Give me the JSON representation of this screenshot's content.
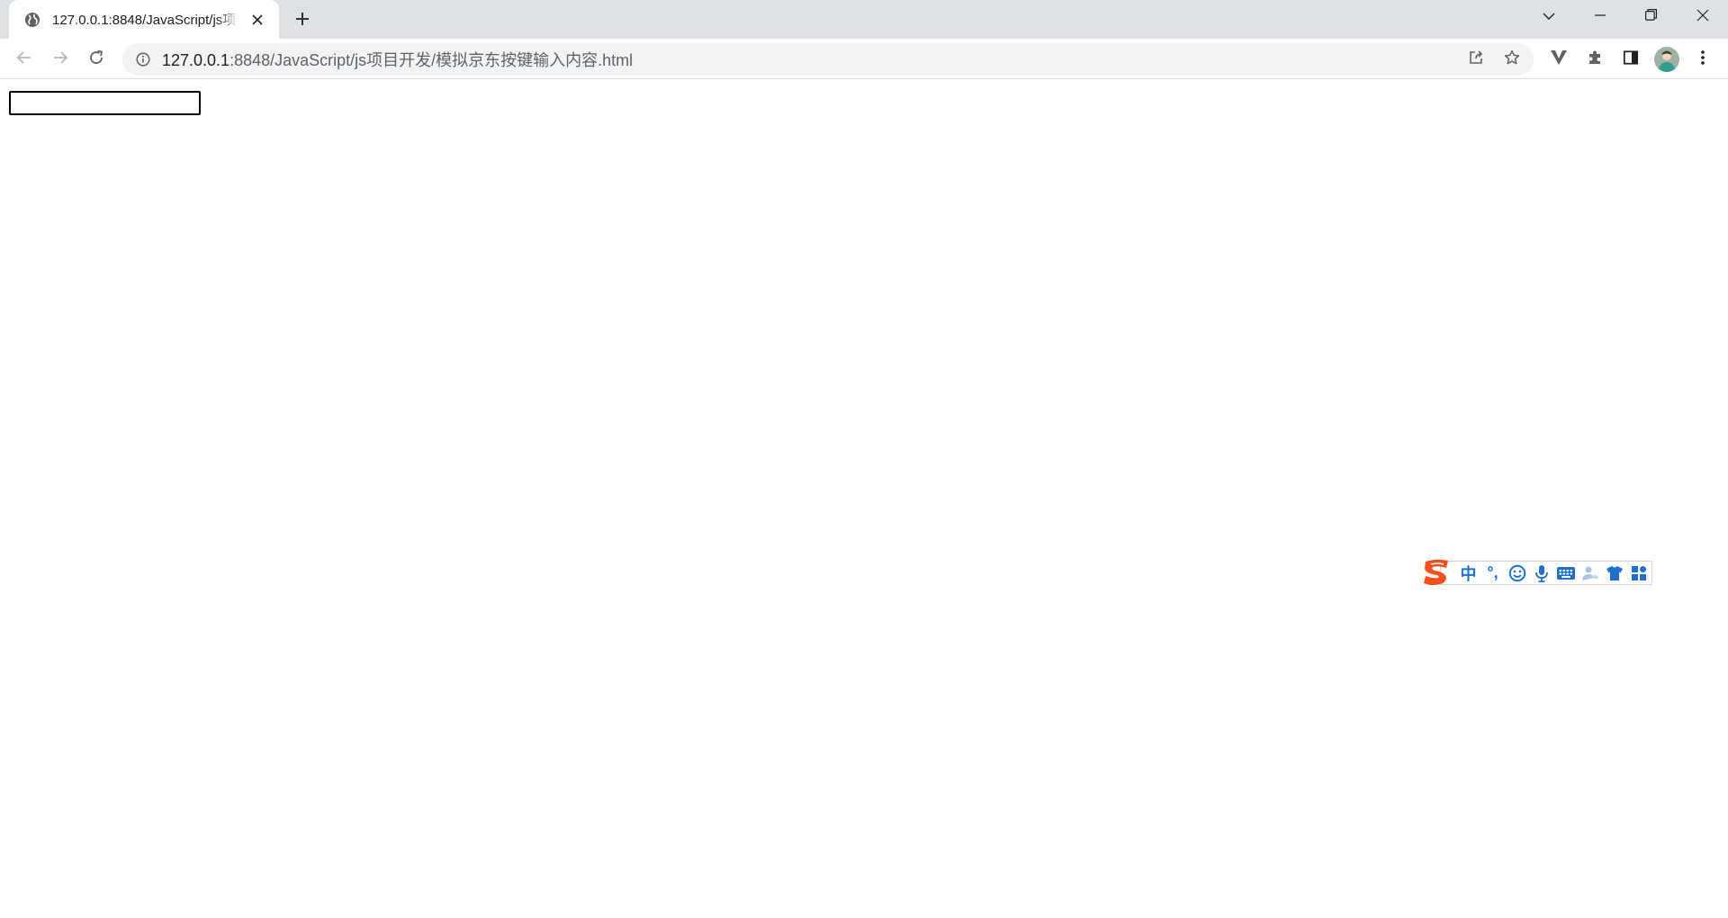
{
  "browser": {
    "tab": {
      "title": "127.0.0.1:8848/JavaScript/js项目开发/模拟京东按键输入内容.html"
    },
    "address_bar": {
      "host": "127.0.0.1",
      "path": ":8848/JavaScript/js项目开发/模拟京东按键输入内容.html"
    },
    "icons": {
      "favicon": "globe-icon",
      "tab_close": "close-icon",
      "new_tab": "plus-icon",
      "tab_search": "chevron-down-icon",
      "minimize": "minimize-icon",
      "restore": "restore-icon",
      "close_window": "close-icon",
      "back": "arrow-left-icon",
      "forward": "arrow-right-icon",
      "reload": "reload-icon",
      "site_info": "info-icon",
      "share": "share-icon",
      "bookmark": "star-icon",
      "extension_v": "v-extension-icon",
      "extensions": "puzzle-icon",
      "side_panel": "side-panel-icon",
      "profile": "avatar",
      "menu": "kebab-menu-icon"
    },
    "colors": {
      "tab_strip": "#dee1e6",
      "omnibox": "#f1f3f4",
      "icon": "#5f6368"
    }
  },
  "page": {
    "search_input": {
      "value": "",
      "placeholder": ""
    }
  },
  "ime": {
    "mode_label": "中",
    "punct_label": "°,",
    "icons": [
      "sogou-logo-icon",
      "emoji-icon",
      "microphone-icon",
      "keyboard-icon",
      "user-icon",
      "skin-icon",
      "toolbox-icon"
    ],
    "accent": "#1e6fd0",
    "logo_color": "#f4511e"
  }
}
